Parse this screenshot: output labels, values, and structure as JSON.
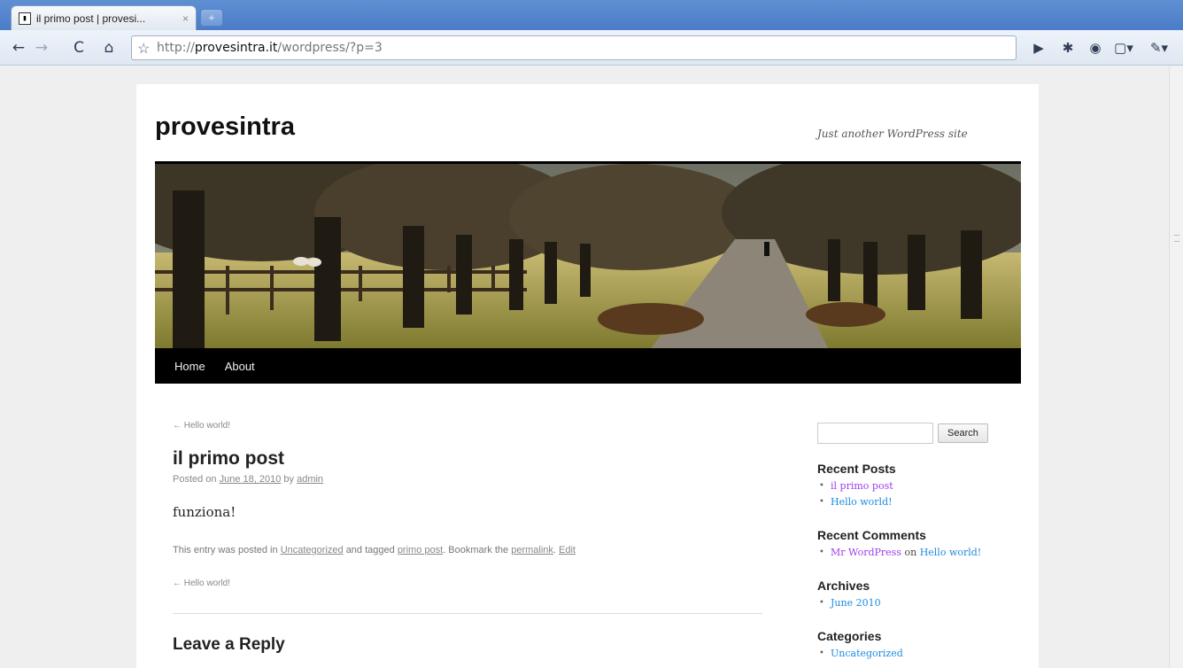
{
  "browser": {
    "tab_title": "il primo post | provesi...",
    "tab_close": "×",
    "new_tab": "+",
    "url_prefix": "http://",
    "url_host": "provesintra.it",
    "url_path": "/wordpress/?p=3"
  },
  "site": {
    "title": "provesintra",
    "description": "Just another WordPress site"
  },
  "menu": {
    "items": [
      {
        "label": "Home"
      },
      {
        "label": "About"
      }
    ]
  },
  "post": {
    "prev_link_top": "← Hello world!",
    "title": "il primo post",
    "meta_posted_on": "Posted on",
    "meta_date": "June 18, 2010",
    "meta_by": "by",
    "meta_author": "admin",
    "body": "funziona!",
    "footer_prefix": "This entry was posted in",
    "category": "Uncategorized",
    "footer_tagged": "and tagged",
    "tag": "primo post",
    "footer_bookmark": ". Bookmark the",
    "permalink": "permalink",
    "footer_period": ".",
    "edit": "Edit",
    "prev_link_bottom": "← Hello world!",
    "reply_title": "Leave a Reply"
  },
  "sidebar": {
    "search_button": "Search",
    "recent_posts_title": "Recent Posts",
    "recent_posts": [
      "il primo post",
      "Hello world!"
    ],
    "recent_comments_title": "Recent Comments",
    "comment_author": "Mr WordPress",
    "comment_on": "on",
    "comment_post": "Hello world!",
    "archives_title": "Archives",
    "archives": [
      "June 2010"
    ],
    "categories_title": "Categories",
    "categories": [
      "Uncategorized"
    ]
  },
  "colors": {
    "link": "#1b8be0",
    "visited_link": "#9f3def",
    "menu_bar": "#000000"
  }
}
